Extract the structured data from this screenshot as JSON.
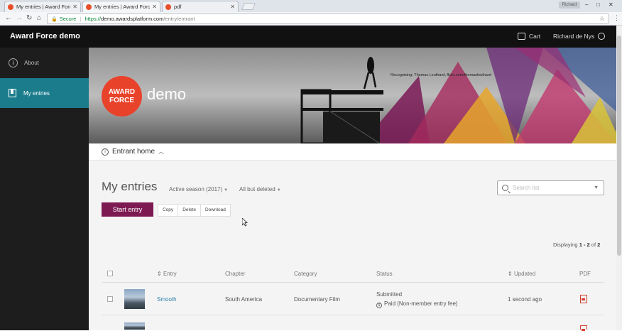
{
  "browser": {
    "tabs": [
      {
        "label": "My entries | Award Force"
      },
      {
        "label": "My entries | Award Force"
      },
      {
        "label": "pdf"
      }
    ],
    "user_chip": "Richard",
    "address": {
      "secure_label": "Secure",
      "url_scheme": "https://",
      "url_host": "demo.awardsplatform.com",
      "url_path": "/entry/entrant"
    }
  },
  "header": {
    "brand": "Award Force demo",
    "cart_label": "Cart",
    "user_name": "Richard de Nys"
  },
  "sidebar": {
    "items": [
      {
        "label": "About",
        "icon": "info-icon"
      },
      {
        "label": "My entries",
        "icon": "bookmark-icon"
      }
    ]
  },
  "banner": {
    "logo_line1": "AWARD",
    "logo_line2": "FORCE",
    "logo_suffix": "demo",
    "credit": "Recognising: Thomas Leuthard, flickr.com/thomasleuthard"
  },
  "entrant_home": {
    "label": "Entrant home"
  },
  "page": {
    "title": "My entries",
    "season_filter": "Active season (2017)",
    "status_filter": "All but deleted",
    "search_placeholder": "Search list",
    "start_entry": "Start entry",
    "actions": [
      "Copy",
      "Delete",
      "Download"
    ],
    "displaying_prefix": "Displaying ",
    "displaying_range": "1 - 2",
    "displaying_of": " of ",
    "displaying_total": "2"
  },
  "table": {
    "columns": [
      "Entry",
      "Chapter",
      "Category",
      "Status",
      "Updated",
      "PDF"
    ],
    "rows": [
      {
        "entry": "Smooth",
        "chapter": "South America",
        "category": "Documentary Film",
        "status": "Submitted",
        "payment": "Paid (Non-member entry fee)",
        "updated": "1 second ago"
      }
    ]
  },
  "colors": {
    "accent": "#7d1a52",
    "sidebar_active": "#1b7c8c",
    "logo_red": "#e8432a"
  }
}
